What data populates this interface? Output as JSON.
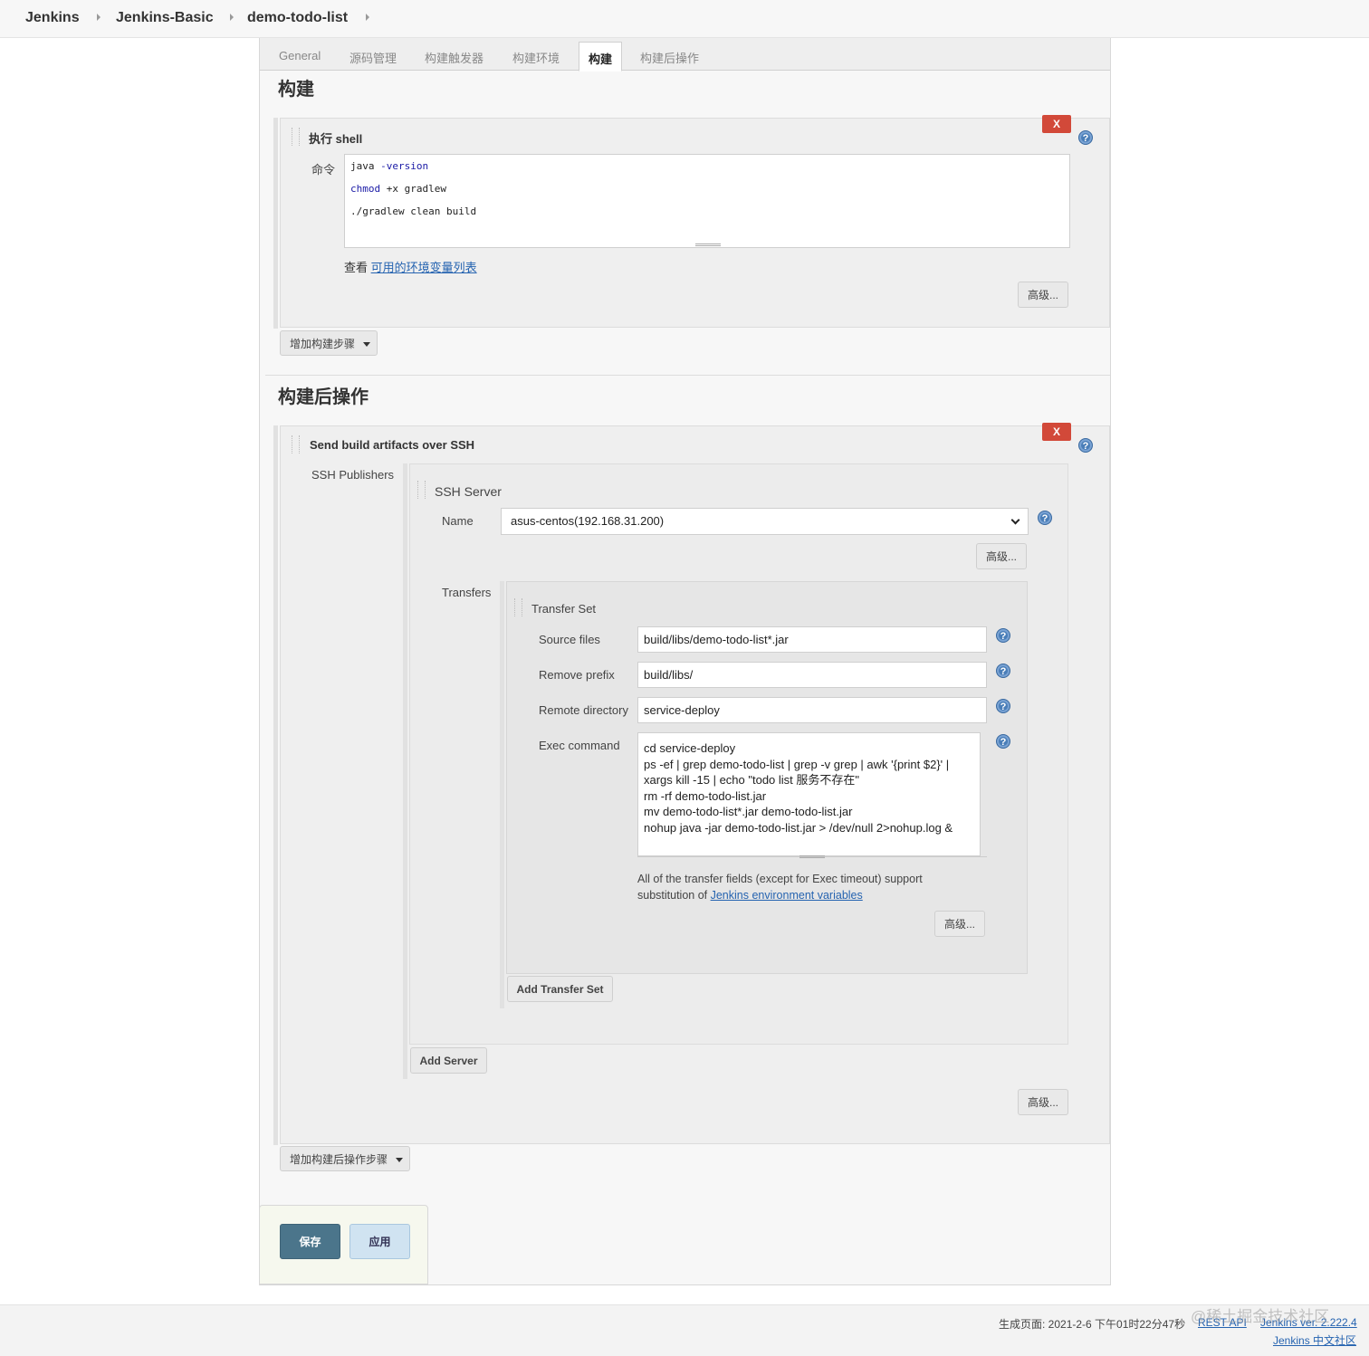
{
  "breadcrumb": [
    "Jenkins",
    "Jenkins-Basic",
    "demo-todo-list"
  ],
  "tabs": [
    "General",
    "源码管理",
    "构建触发器",
    "构建环境",
    "构建",
    "构建后操作"
  ],
  "build": {
    "section_title": "构建",
    "step_title": "执行 shell",
    "delete_label": "X",
    "command_label": "命令",
    "command_lines": [
      {
        "prefix": "java ",
        "kw": "-version",
        "rest": ""
      },
      {
        "prefix": "",
        "kw": "chmod",
        "rest": " +x gradlew"
      },
      {
        "prefix": "./gradlew clean build",
        "kw": "",
        "rest": ""
      }
    ],
    "env_prefix": "查看 ",
    "env_link": "可用的环境变量列表",
    "advanced": "高级...",
    "add_step": "增加构建步骤"
  },
  "post_build": {
    "section_title": "构建后操作",
    "step_title": "Send build artifacts over SSH",
    "delete_label": "X",
    "publishers_label": "SSH Publishers",
    "server_title": "SSH Server",
    "name_label": "Name",
    "name_value": "asus-centos(192.168.31.200)",
    "server_advanced": "高级...",
    "transfers_label": "Transfers",
    "transfer_set_title": "Transfer Set",
    "fields": [
      {
        "label": "Source files",
        "value": "build/libs/demo-todo-list*.jar"
      },
      {
        "label": "Remove prefix",
        "value": "build/libs/"
      },
      {
        "label": "Remote directory",
        "value": "service-deploy"
      }
    ],
    "exec_label": "Exec command",
    "exec_value": "cd service-deploy\nps -ef | grep demo-todo-list | grep -v grep | awk '{print $2}' |\nxargs kill -15 | echo \"todo list 服务不存在\"\nrm -rf demo-todo-list.jar\nmv demo-todo-list*.jar demo-todo-list.jar\nnohup java -jar demo-todo-list.jar > /dev/null 2>nohup.log &",
    "note_line1": "All of the transfer fields (except for Exec timeout) support",
    "note_line2_prefix": "substitution of ",
    "note_link": "Jenkins environment variables",
    "transfer_advanced": "高级...",
    "add_transfer_set": "Add Transfer Set",
    "add_server": "Add Server",
    "publisher_advanced": "高级...",
    "add_post_step": "增加构建后操作步骤"
  },
  "actions": {
    "save": "保存",
    "apply": "应用"
  },
  "footer": {
    "generated": "生成页面: 2021-2-6 下午01时22分47秒",
    "rest_api": "REST API",
    "version": "Jenkins ver. 2.222.4",
    "community": "Jenkins 中文社区",
    "watermark": "@稀土掘金技术社区"
  },
  "icons": {
    "help": "help-icon",
    "delete": "delete-icon",
    "dropdown": "chevron-down-icon",
    "drag": "drag-handle-icon"
  },
  "colors": {
    "delete": "#d24939",
    "save": "#4b758b",
    "apply": "#d0e3f1",
    "link": "#2563b0",
    "help": "#4a7eb8"
  }
}
